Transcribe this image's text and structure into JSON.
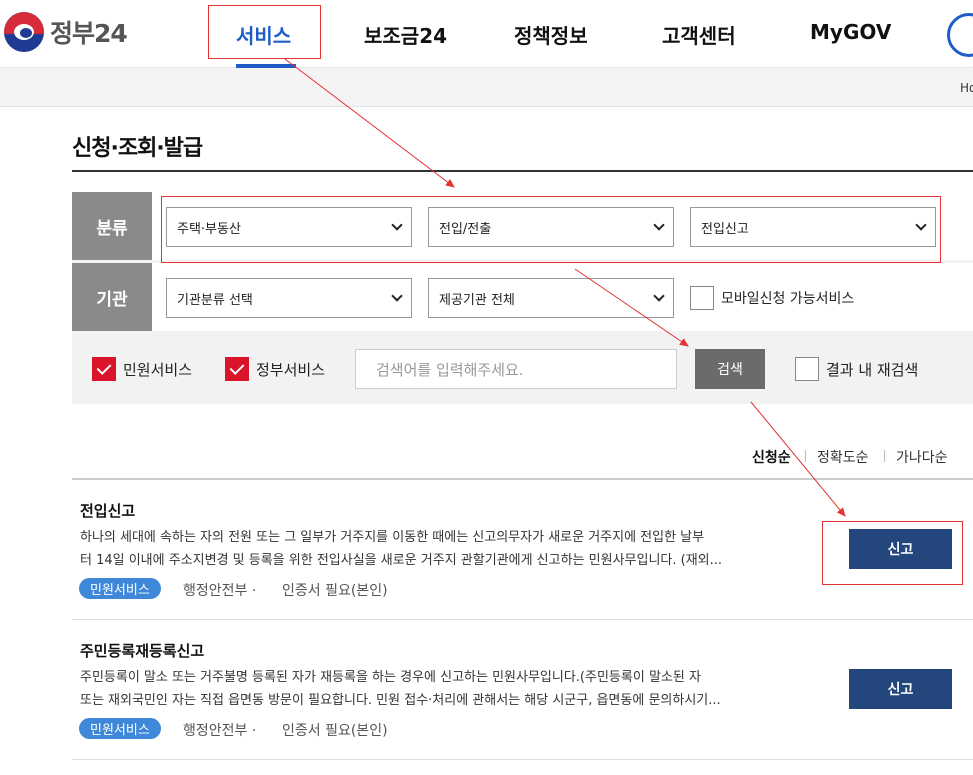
{
  "header": {
    "logo_text": "정부24",
    "nav": [
      "서비스",
      "보조금24",
      "정책정보",
      "고객센터",
      "MyGOV"
    ],
    "breadcrumb_home": "Ho"
  },
  "page": {
    "title": "신청·조회·발급"
  },
  "filter": {
    "category_label": "분류",
    "category_select1": "주택·부동산",
    "category_select2": "전입/전출",
    "category_select3": "전입신고",
    "agency_label": "기관",
    "agency_select1": "기관분류 선택",
    "agency_select2": "제공기관 전체",
    "mobile_label": "모바일신청 가능서비스",
    "mobile_checked": false,
    "civil_label": "민원서비스",
    "civil_checked": true,
    "gov_label": "정부서비스",
    "gov_checked": true,
    "search_placeholder": "검색어를 입력해주세요.",
    "search_button": "검색",
    "research_label": "결과 내 재검색",
    "research_checked": false
  },
  "sort": {
    "options": [
      "신청순",
      "정확도순",
      "가나다순"
    ],
    "active": "신청순"
  },
  "results": [
    {
      "title": "전입신고",
      "desc_line1": "하나의 세대에 속하는 자의 전원 또는 그 일부가 거주지를 이동한 때에는 신고의무자가 새로운 거주지에 전입한 날부",
      "desc_line2": "터 14일 이내에 주소지변경 및 등록을 위한 전입사실을 새로운 거주지 관할기관에게 신고하는 민원사무입니다. (재외...",
      "badge": "민원서비스",
      "agency": "행정안전부",
      "cert": "인증서 필요(본인)",
      "button": "신고"
    },
    {
      "title": "주민등록재등록신고",
      "desc_line1": "주민등록이 말소 또는 거주불명 등록된 자가 재등록을 하는 경우에 신고하는 민원사무입니다.(주민등록이 말소된 자",
      "desc_line2": "또는 재외국민인 자는 직접 읍면동 방문이 필요합니다. 민원 접수·처리에 관해서는 해당 시군구, 읍면동에 문의하시기...",
      "badge": "민원서비스",
      "agency": "행정안전부",
      "cert": "인증서 필요(본인)",
      "button": "신고"
    }
  ],
  "colors": {
    "accent": "#1e5cc8",
    "check": "#d8132a",
    "apply_button": "#23467c",
    "badge": "#3f87d9",
    "annotation": "#e43232"
  }
}
